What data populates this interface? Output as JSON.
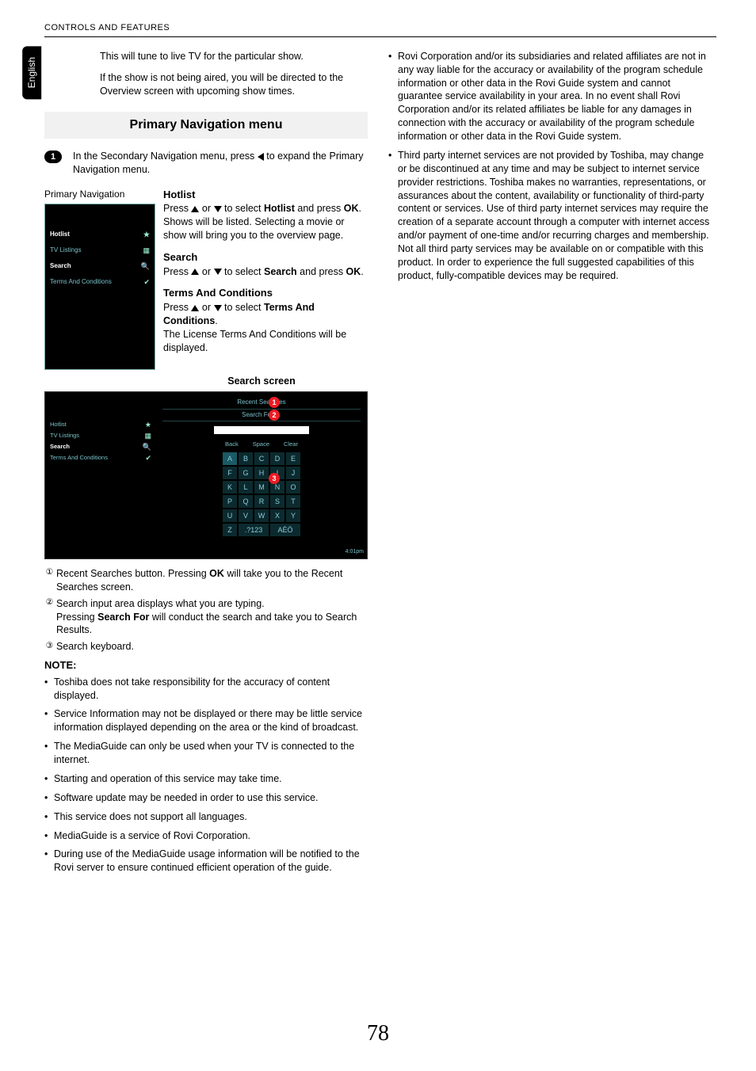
{
  "header": "CONTROLS AND FEATURES",
  "lang_tab": "English",
  "page_number": "78",
  "col1": {
    "intro1": "This will tune to live TV for the particular show.",
    "intro2": "If the show is not being aired, you will be directed to the Overview screen with upcoming show times.",
    "primary_nav_title": "Primary Navigation menu",
    "step1_num": "1",
    "step1_text_a": "In the Secondary Navigation menu, press ",
    "step1_text_b": " to expand the Primary Navigation menu.",
    "fig1_label": "Primary Navigation",
    "fig1_items": [
      {
        "label": "Hotlist",
        "icon": "★",
        "bold": true
      },
      {
        "label": "TV Listings",
        "icon": "▦",
        "bold": false
      },
      {
        "label": "Search",
        "icon": "🔍",
        "bold": true
      },
      {
        "label": "Terms And Conditions",
        "icon": "✔",
        "bold": false
      }
    ],
    "hotlist": {
      "title": "Hotlist",
      "body_a": "Press ",
      "body_b": " or ",
      "body_c": " to select ",
      "body_bold": "Hotlist",
      "body_d": " and press ",
      "body_ok": "OK",
      "body_e": ". Shows will be listed. Selecting a movie or show will bring you to the overview page."
    },
    "search": {
      "title": "Search",
      "body_a": "Press ",
      "body_b": " or ",
      "body_c": " to select ",
      "body_bold": "Search",
      "body_d": " and press ",
      "body_ok": "OK",
      "body_e": "."
    },
    "tac": {
      "title": "Terms And Conditions",
      "body_a": "Press ",
      "body_b": " or ",
      "body_c": " to select ",
      "body_bold": "Terms And Conditions",
      "body_e": ".",
      "body_f": "The License Terms And Conditions will be displayed."
    },
    "search_caption": "Search screen",
    "search_fig": {
      "recent": "Recent Searches",
      "search_for": "Search For ▲",
      "ctrl": [
        "Back",
        "Space",
        "Clear"
      ],
      "keys": [
        "A",
        "B",
        "C",
        "D",
        "E",
        "F",
        "G",
        "H",
        "I",
        "J",
        "K",
        "L",
        "M",
        "N",
        "O",
        "P",
        "Q",
        "R",
        "S",
        "T",
        "U",
        "V",
        "W",
        "X",
        "Y"
      ],
      "bottom": [
        "Z",
        ".?123",
        "AÈÖ"
      ],
      "callouts": {
        "c1": "1",
        "c2": "2",
        "c3": "3"
      },
      "time": "4:01pm"
    },
    "legend": {
      "l1_a": "Recent Searches button. Pressing ",
      "l1_ok": "OK",
      "l1_b": " will take you to the Recent Searches screen.",
      "l2_a": "Search input area displays what you are typing.",
      "l2_b_a": "Pressing ",
      "l2_b_bold": "Search For",
      "l2_b_b": " will conduct the search and take you to Search Results.",
      "l3": "Search keyboard."
    },
    "note_head": "NOTE:",
    "notes": [
      "Toshiba does not take responsibility for the accuracy of content displayed.",
      "Service Information may not be displayed or there may be little service information displayed depending on the area or the kind of broadcast.",
      "The MediaGuide can only be used when your TV is connected to the internet.",
      "Starting and operation of this service may take time.",
      "Software update may be needed in order to use this service.",
      "This service does not support all languages.",
      "MediaGuide is a service of Rovi Corporation.",
      "During use of the MediaGuide usage information will be notified to the Rovi server to ensure continued efficient operation of the guide."
    ]
  },
  "col2": {
    "bullets": [
      "Rovi Corporation and/or its subsidiaries and related affiliates are not in any way liable for the accuracy or availability of the program schedule information or other data in the Rovi Guide system and cannot guarantee service availability in your area. In no event shall Rovi Corporation and/or its related affiliates be liable for any damages in connection with the accuracy or availability of the program schedule information or other data in the Rovi Guide system.",
      "Third party internet services are not provided by Toshiba, may change or be discontinued at any time and may be subject to internet service provider restrictions. Toshiba makes no warranties, representations, or assurances about the content, availability or functionality of third-party content or services. Use of third party internet services may require the creation of a separate account through a computer with internet access and/or payment of one-time and/or recurring charges and membership. Not all third party services may be available on or compatible with this product. In order to experience the full suggested capabilities of this product, fully-compatible devices may be required."
    ]
  }
}
